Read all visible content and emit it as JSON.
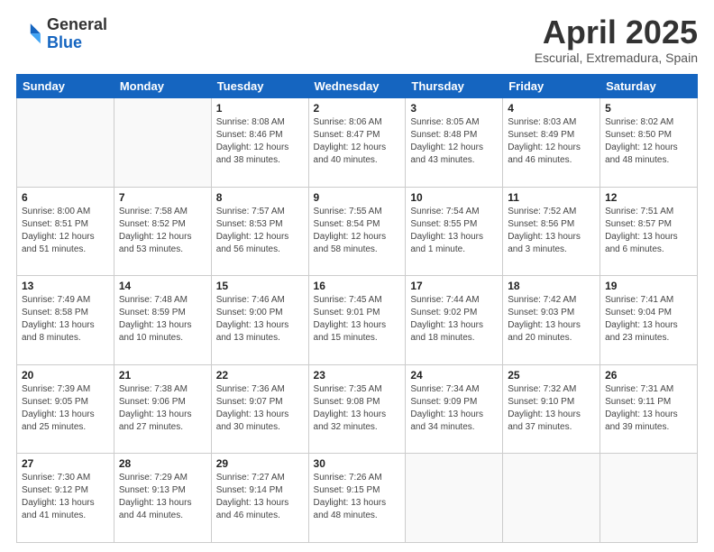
{
  "header": {
    "logo_general": "General",
    "logo_blue": "Blue",
    "month_title": "April 2025",
    "subtitle": "Escurial, Extremadura, Spain"
  },
  "days_of_week": [
    "Sunday",
    "Monday",
    "Tuesday",
    "Wednesday",
    "Thursday",
    "Friday",
    "Saturday"
  ],
  "weeks": [
    [
      {
        "day": "",
        "info": ""
      },
      {
        "day": "",
        "info": ""
      },
      {
        "day": "1",
        "info": "Sunrise: 8:08 AM\nSunset: 8:46 PM\nDaylight: 12 hours and 38 minutes."
      },
      {
        "day": "2",
        "info": "Sunrise: 8:06 AM\nSunset: 8:47 PM\nDaylight: 12 hours and 40 minutes."
      },
      {
        "day": "3",
        "info": "Sunrise: 8:05 AM\nSunset: 8:48 PM\nDaylight: 12 hours and 43 minutes."
      },
      {
        "day": "4",
        "info": "Sunrise: 8:03 AM\nSunset: 8:49 PM\nDaylight: 12 hours and 46 minutes."
      },
      {
        "day": "5",
        "info": "Sunrise: 8:02 AM\nSunset: 8:50 PM\nDaylight: 12 hours and 48 minutes."
      }
    ],
    [
      {
        "day": "6",
        "info": "Sunrise: 8:00 AM\nSunset: 8:51 PM\nDaylight: 12 hours and 51 minutes."
      },
      {
        "day": "7",
        "info": "Sunrise: 7:58 AM\nSunset: 8:52 PM\nDaylight: 12 hours and 53 minutes."
      },
      {
        "day": "8",
        "info": "Sunrise: 7:57 AM\nSunset: 8:53 PM\nDaylight: 12 hours and 56 minutes."
      },
      {
        "day": "9",
        "info": "Sunrise: 7:55 AM\nSunset: 8:54 PM\nDaylight: 12 hours and 58 minutes."
      },
      {
        "day": "10",
        "info": "Sunrise: 7:54 AM\nSunset: 8:55 PM\nDaylight: 13 hours and 1 minute."
      },
      {
        "day": "11",
        "info": "Sunrise: 7:52 AM\nSunset: 8:56 PM\nDaylight: 13 hours and 3 minutes."
      },
      {
        "day": "12",
        "info": "Sunrise: 7:51 AM\nSunset: 8:57 PM\nDaylight: 13 hours and 6 minutes."
      }
    ],
    [
      {
        "day": "13",
        "info": "Sunrise: 7:49 AM\nSunset: 8:58 PM\nDaylight: 13 hours and 8 minutes."
      },
      {
        "day": "14",
        "info": "Sunrise: 7:48 AM\nSunset: 8:59 PM\nDaylight: 13 hours and 10 minutes."
      },
      {
        "day": "15",
        "info": "Sunrise: 7:46 AM\nSunset: 9:00 PM\nDaylight: 13 hours and 13 minutes."
      },
      {
        "day": "16",
        "info": "Sunrise: 7:45 AM\nSunset: 9:01 PM\nDaylight: 13 hours and 15 minutes."
      },
      {
        "day": "17",
        "info": "Sunrise: 7:44 AM\nSunset: 9:02 PM\nDaylight: 13 hours and 18 minutes."
      },
      {
        "day": "18",
        "info": "Sunrise: 7:42 AM\nSunset: 9:03 PM\nDaylight: 13 hours and 20 minutes."
      },
      {
        "day": "19",
        "info": "Sunrise: 7:41 AM\nSunset: 9:04 PM\nDaylight: 13 hours and 23 minutes."
      }
    ],
    [
      {
        "day": "20",
        "info": "Sunrise: 7:39 AM\nSunset: 9:05 PM\nDaylight: 13 hours and 25 minutes."
      },
      {
        "day": "21",
        "info": "Sunrise: 7:38 AM\nSunset: 9:06 PM\nDaylight: 13 hours and 27 minutes."
      },
      {
        "day": "22",
        "info": "Sunrise: 7:36 AM\nSunset: 9:07 PM\nDaylight: 13 hours and 30 minutes."
      },
      {
        "day": "23",
        "info": "Sunrise: 7:35 AM\nSunset: 9:08 PM\nDaylight: 13 hours and 32 minutes."
      },
      {
        "day": "24",
        "info": "Sunrise: 7:34 AM\nSunset: 9:09 PM\nDaylight: 13 hours and 34 minutes."
      },
      {
        "day": "25",
        "info": "Sunrise: 7:32 AM\nSunset: 9:10 PM\nDaylight: 13 hours and 37 minutes."
      },
      {
        "day": "26",
        "info": "Sunrise: 7:31 AM\nSunset: 9:11 PM\nDaylight: 13 hours and 39 minutes."
      }
    ],
    [
      {
        "day": "27",
        "info": "Sunrise: 7:30 AM\nSunset: 9:12 PM\nDaylight: 13 hours and 41 minutes."
      },
      {
        "day": "28",
        "info": "Sunrise: 7:29 AM\nSunset: 9:13 PM\nDaylight: 13 hours and 44 minutes."
      },
      {
        "day": "29",
        "info": "Sunrise: 7:27 AM\nSunset: 9:14 PM\nDaylight: 13 hours and 46 minutes."
      },
      {
        "day": "30",
        "info": "Sunrise: 7:26 AM\nSunset: 9:15 PM\nDaylight: 13 hours and 48 minutes."
      },
      {
        "day": "",
        "info": ""
      },
      {
        "day": "",
        "info": ""
      },
      {
        "day": "",
        "info": ""
      }
    ]
  ]
}
